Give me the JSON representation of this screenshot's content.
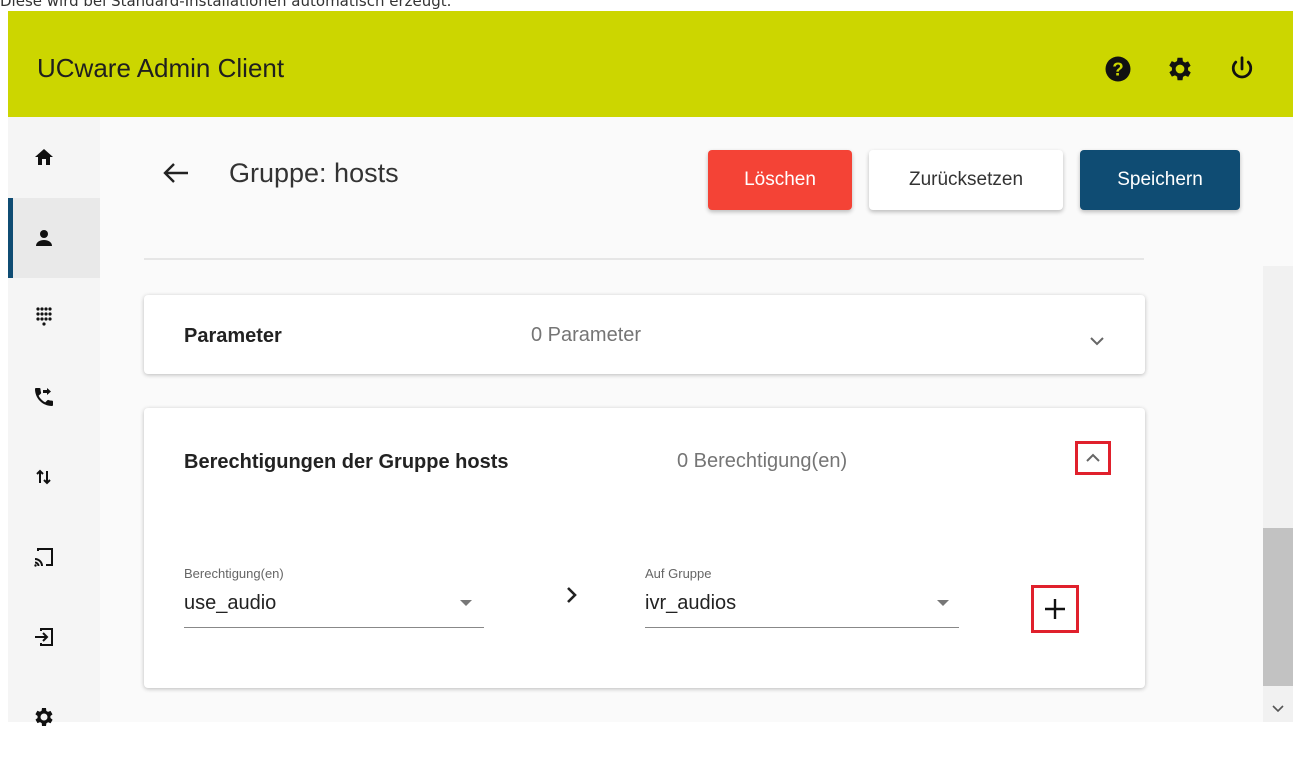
{
  "caption": "Diese wird bei Standard-Installationen automatisch erzeugt.",
  "app": {
    "title": "UCware Admin Client"
  },
  "top_icons": [
    "help-circle-icon",
    "gear-icon",
    "power-icon"
  ],
  "sidebar": {
    "items": [
      {
        "icon": "home-icon",
        "active": false
      },
      {
        "icon": "user-icon",
        "active": true
      },
      {
        "icon": "dialpad-icon",
        "active": false
      },
      {
        "icon": "call-forward-icon",
        "active": false
      },
      {
        "icon": "swap-vertical-icon",
        "active": false
      },
      {
        "icon": "cast-icon",
        "active": false
      },
      {
        "icon": "login-icon",
        "active": false
      },
      {
        "icon": "gear-icon",
        "active": false
      }
    ]
  },
  "page": {
    "title": "Gruppe: hosts",
    "buttons": {
      "delete": "Löschen",
      "reset": "Zurücksetzen",
      "save": "Speichern"
    }
  },
  "params_panel": {
    "title": "Parameter",
    "summary": "0 Parameter"
  },
  "perm_panel": {
    "title": "Berechtigungen der Gruppe hosts",
    "summary": "0 Berechtigung(en)",
    "permission_field": {
      "label": "Berechtigung(en)",
      "value": "use_audio"
    },
    "group_field": {
      "label": "Auf Gruppe",
      "value": "ivr_audios"
    }
  },
  "colors": {
    "topbar": "#ccd600",
    "delete": "#f44336",
    "save": "#0f4c73",
    "highlight": "#e0202c"
  }
}
